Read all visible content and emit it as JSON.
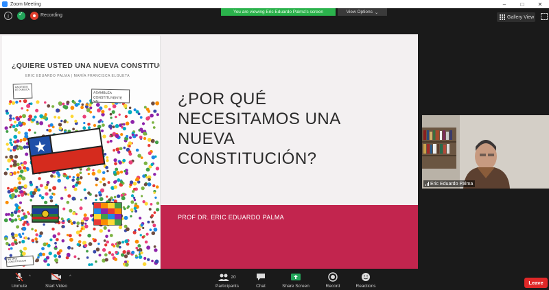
{
  "window": {
    "title": "Zoom Meeting"
  },
  "top_bar": {
    "recording_label": "Recording",
    "share_banner": "You are viewing Eric Eduardo Palma's screen",
    "view_options_label": "View Options",
    "gallery_view_label": "Gallery View"
  },
  "slide": {
    "book_title_line": "¿QUIERE USTED UNA NUEVA CONSTITUCIÓN?",
    "book_authors": "ERIC EDUARDO PALMA | MARÍA FRANCISCA ELGUETA",
    "book_sign_1": "HACIENDO FE PUBLICA",
    "book_sign_2": "ASAMBLEA CONSTITUYENTE YA!",
    "book_sign_3": "NO MAS CONSTITUCION",
    "heading_lines": [
      "¿POR QUÉ",
      "NECESITAMOS UNA",
      "NUEVA",
      "CONSTITUCIÓN?"
    ],
    "footer_text": "PROF DR. ERIC EDUARDO PALMA",
    "colors": {
      "accent_band": "#c2254e",
      "slide_bg": "#f3f0f1"
    }
  },
  "participant": {
    "name": "Eric Eduardo Palma"
  },
  "toolbar": {
    "unmute": "Unmute",
    "start_video": "Start Video",
    "participants": "Participants",
    "participants_count": "20",
    "chat": "Chat",
    "share_screen": "Share Screen",
    "record": "Record",
    "reactions": "Reactions",
    "leave": "Leave"
  }
}
